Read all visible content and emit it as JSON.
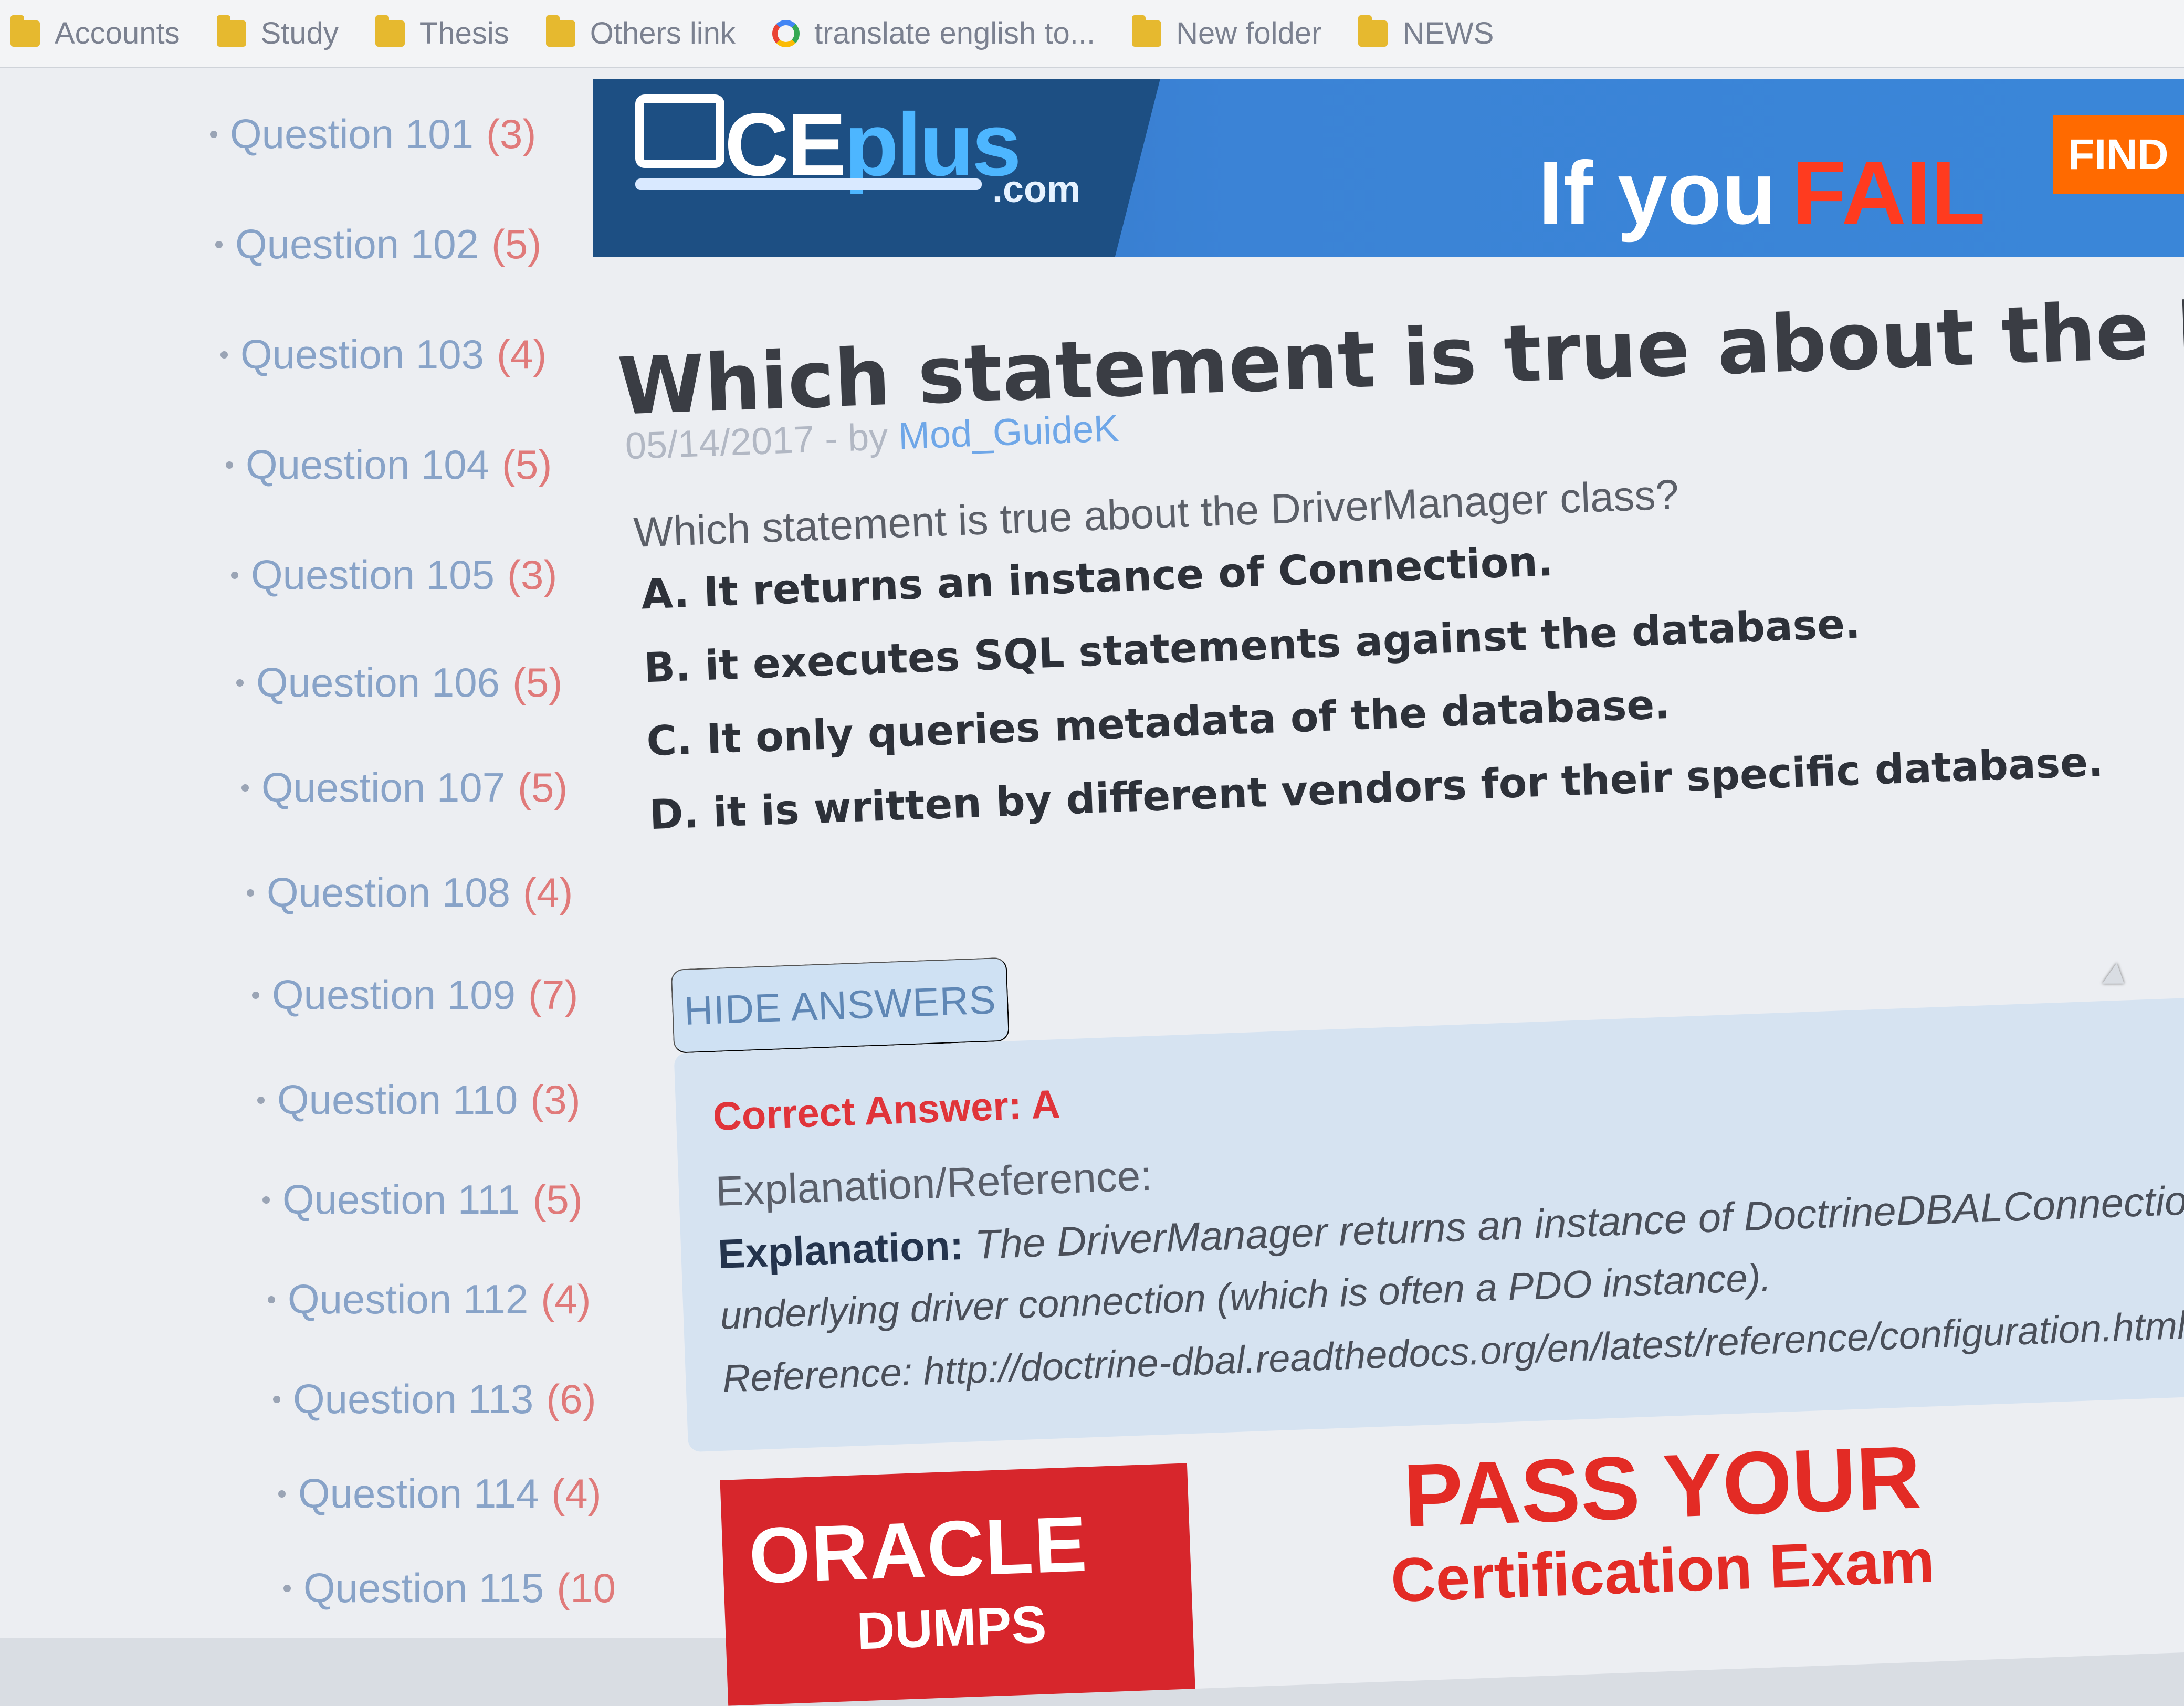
{
  "bookmarks": [
    {
      "label": "Accounts",
      "icon": "folder-icon"
    },
    {
      "label": "Study",
      "icon": "folder-icon"
    },
    {
      "label": "Thesis",
      "icon": "folder-icon"
    },
    {
      "label": "Others link",
      "icon": "folder-icon"
    },
    {
      "label": "translate english to...",
      "icon": "google-icon"
    },
    {
      "label": "New folder",
      "icon": "folder-icon"
    },
    {
      "label": "NEWS",
      "icon": "folder-icon"
    }
  ],
  "sidebar": {
    "items": [
      {
        "label": "Question 101",
        "count": "(3)"
      },
      {
        "label": "Question 102",
        "count": "(5)"
      },
      {
        "label": "Question 103",
        "count": "(4)"
      },
      {
        "label": "Question 104",
        "count": "(5)"
      },
      {
        "label": "Question 105",
        "count": "(3)"
      },
      {
        "label": "Question 106",
        "count": "(5)"
      },
      {
        "label": "Question 107",
        "count": "(5)"
      },
      {
        "label": "Question 108",
        "count": "(4)"
      },
      {
        "label": "Question 109",
        "count": "(7)"
      },
      {
        "label": "Question 110",
        "count": "(3)"
      },
      {
        "label": "Question 111",
        "count": "(5)"
      },
      {
        "label": "Question 112",
        "count": "(4)"
      },
      {
        "label": "Question 113",
        "count": "(6)"
      },
      {
        "label": "Question 114",
        "count": "(4)"
      },
      {
        "label": "Question 115",
        "count": "(10"
      }
    ]
  },
  "banner": {
    "logo_main": "CE",
    "logo_plus": "plus",
    "logo_domain": ".com",
    "headline_prefix": "If you",
    "headline_fail": "FAIL",
    "find_button": "FIND"
  },
  "main": {
    "title": "Which statement is true about the DriverManage",
    "date": "05/14/2017",
    "by_label": " - by ",
    "author": "Mod_GuideK",
    "question": "Which statement is true about the DriverManager class?",
    "options": [
      "A. It returns an instance of Connection.",
      "B. it executes SQL statements against the database.",
      "C. It only queries metadata of the database.",
      "D. it is written by different vendors for their specific database."
    ],
    "hide_answers": "HIDE ANSWERS",
    "correct_answer": "Correct Answer: A",
    "explanation_reference_label": "Explanation/Reference:",
    "explanation_label": "Explanation:",
    "explanation_text": "The DriverManager returns an instance of DoctrineDBALConnection which is a wr",
    "explanation_text_2": "underlying driver connection (which is often a PDO instance).",
    "reference": "Reference: http://doctrine-dbal.readthedocs.org/en/latest/reference/configuration.html"
  },
  "bottom_ad": {
    "oracle": "ORACLE",
    "dumps": "DUMPS",
    "pass": "PASS YOUR",
    "certification": "Certification Exam"
  }
}
